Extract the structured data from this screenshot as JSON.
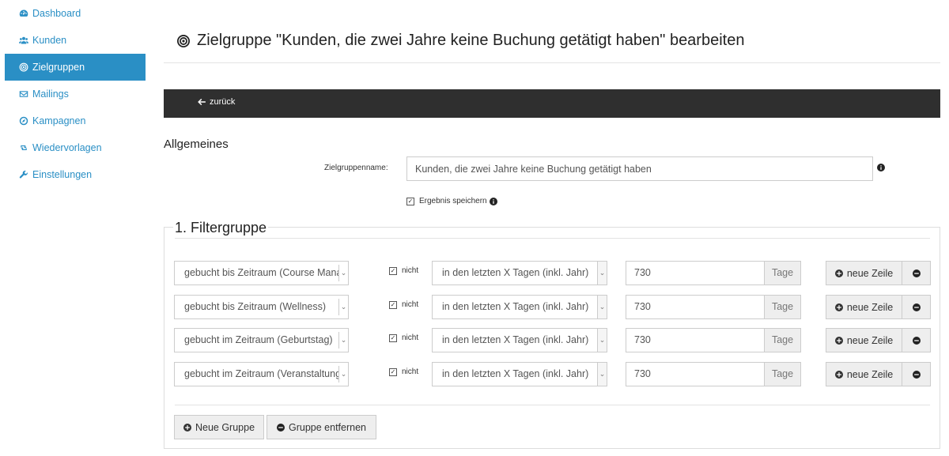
{
  "sidebar": {
    "items": [
      {
        "label": "Dashboard",
        "icon": "dashboard-icon"
      },
      {
        "label": "Kunden",
        "icon": "users-icon"
      },
      {
        "label": "Zielgruppen",
        "icon": "target-icon",
        "active": true
      },
      {
        "label": "Mailings",
        "icon": "envelope-icon"
      },
      {
        "label": "Kampagnen",
        "icon": "compass-icon"
      },
      {
        "label": "Wiedervorlagen",
        "icon": "retweet-icon"
      },
      {
        "label": "Einstellungen",
        "icon": "wrench-icon"
      }
    ]
  },
  "header": {
    "title": "Zielgruppe \"Kunden, die zwei Jahre keine Buchung getätigt haben\" bearbeiten"
  },
  "toolbar": {
    "back_label": "zurück"
  },
  "general": {
    "title": "Allgemeines",
    "name_label": "Zielgruppenname:",
    "name_value": "Kunden, die zwei Jahre keine Buchung getätigt haben",
    "save_result_label": "Ergebnis speichern",
    "save_result_checked": true
  },
  "filter_group": {
    "title": "1. Filtergruppe",
    "rows": [
      {
        "field": "gebucht bis Zeitraum (Course Mana",
        "negate_label": "nicht",
        "negated": true,
        "operator": "in den letzten X Tagen (inkl. Jahr)",
        "value": "730",
        "unit": "Tage",
        "add_label": "neue Zeile"
      },
      {
        "field": "gebucht bis Zeitraum (Wellness)",
        "negate_label": "nicht",
        "negated": true,
        "operator": "in den letzten X Tagen (inkl. Jahr)",
        "value": "730",
        "unit": "Tage",
        "add_label": "neue Zeile"
      },
      {
        "field": "gebucht im Zeitraum (Geburtstag)",
        "negate_label": "nicht",
        "negated": true,
        "operator": "in den letzten X Tagen (inkl. Jahr)",
        "value": "730",
        "unit": "Tage",
        "add_label": "neue Zeile"
      },
      {
        "field": "gebucht im Zeitraum (Veranstaltung",
        "negate_label": "nicht",
        "negated": true,
        "operator": "in den letzten X Tagen (inkl. Jahr)",
        "value": "730",
        "unit": "Tage",
        "add_label": "neue Zeile"
      }
    ],
    "new_group_label": "Neue Gruppe",
    "remove_group_label": "Gruppe entfernen"
  },
  "colors": {
    "accent": "#2a8fc5",
    "toolbar": "#2f2f2f"
  }
}
